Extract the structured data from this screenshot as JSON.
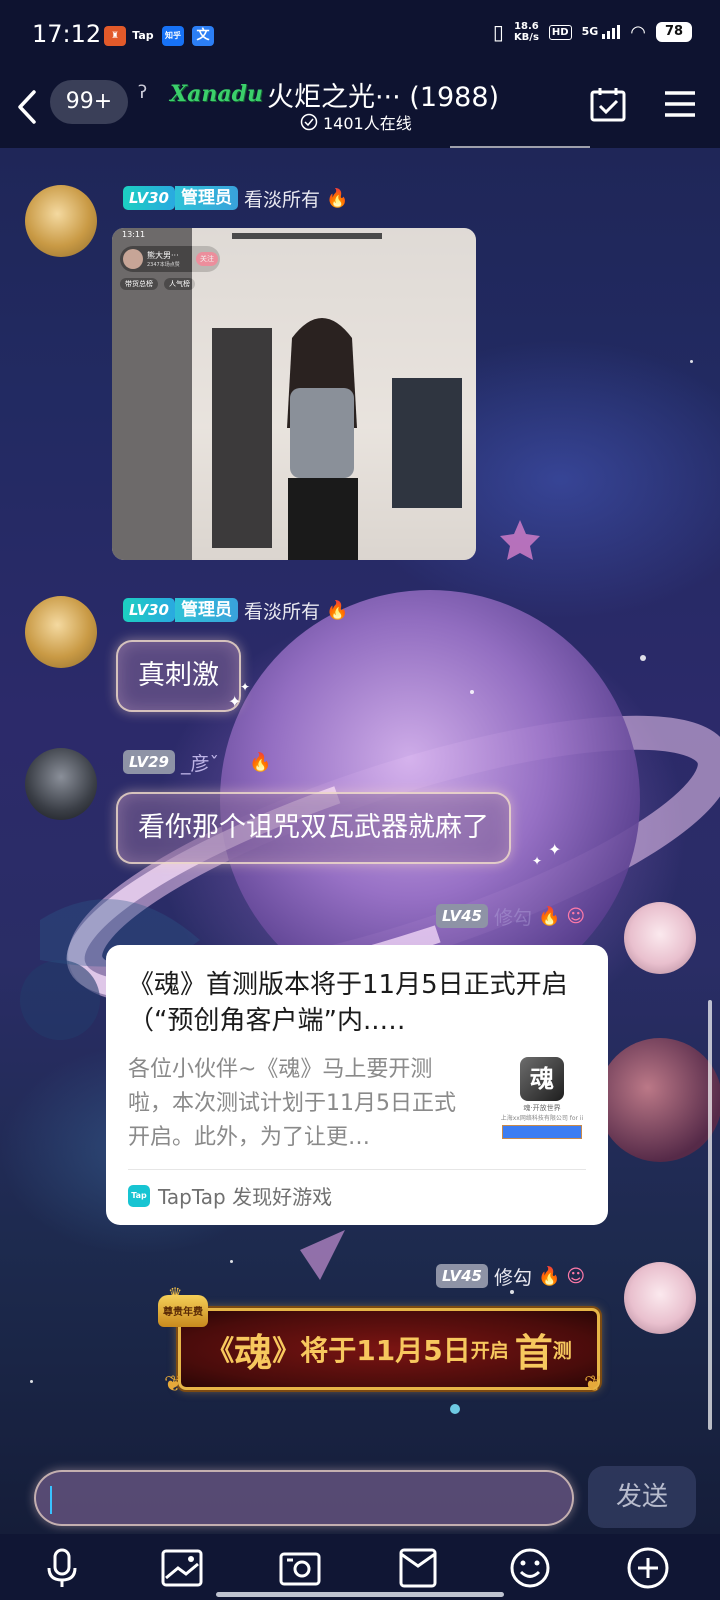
{
  "status_bar": {
    "time": "17:12",
    "app_icons": [
      "Tap",
      "知乎",
      "文"
    ],
    "net_speed_value": "18.6",
    "net_speed_unit": "KB/s",
    "hd": "HD",
    "network": "5G",
    "battery": "78"
  },
  "header": {
    "unread_count": "99+",
    "logo_text": "Xanadu",
    "title": "火炬之光··· (1988)",
    "online_text": "1401人在线"
  },
  "messages": [
    {
      "level": "LV30",
      "role": "管理员",
      "nickname": "看淡所有",
      "type": "video",
      "video": {
        "time": "13:11",
        "streamer_name": "熊大男···",
        "streamer_sub": "2347本场点赞",
        "follow": "关注",
        "tag1": "带货总榜",
        "tag2": "人气榜"
      }
    },
    {
      "level": "LV30",
      "role": "管理员",
      "nickname": "看淡所有",
      "type": "text",
      "text": "真刺激"
    },
    {
      "level": "LV29",
      "nickname": "_彦ˇ",
      "type": "text",
      "text": "看你那个诅咒双瓦武器就麻了"
    },
    {
      "level": "LV45",
      "nickname": "修勾",
      "type": "share",
      "share": {
        "title": "《魂》首测版本将于11月5日正式开启（“预创角客户端”内..…",
        "description": "各位小伙伴~《魂》马上要开测啦，本次测试计划于11月5日正式开启。此外，为了让更…",
        "thumb_title": "魂",
        "thumb_caption": "魂·开放世界",
        "thumb_company": "上海xx网络科技有限公司 for ii",
        "source_icon": "Tap",
        "source": "TapTap 发现好游戏"
      }
    },
    {
      "level": "LV45",
      "nickname": "修勾",
      "type": "banner",
      "banner": {
        "badge": "尊贵年费",
        "part1": "《",
        "part2": "魂",
        "part3": "》将于11月5日",
        "part4": "开启",
        "part5": "首",
        "part6": "测"
      }
    }
  ],
  "input": {
    "value": "",
    "send_label": "发送"
  },
  "toolbar": {
    "icons": [
      "microphone-icon",
      "image-icon",
      "camera-icon",
      "red-packet-icon",
      "emoji-icon",
      "plus-icon"
    ]
  },
  "colors": {
    "level_teal": "#1ccfc1",
    "banner_gold": "#f7c85e",
    "banner_red": "#7a1412"
  }
}
